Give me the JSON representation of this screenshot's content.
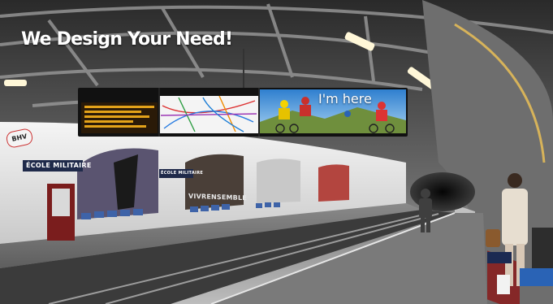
{
  "headline": "We Design Your Need!",
  "screen": {
    "ad_text": "I'm here"
  },
  "signs": {
    "station_left": "ÉCOLE MILITAIRE",
    "station_right": "ÉCOLE MILITAIRE",
    "wall_poster": "VIVRENSEMBLE"
  },
  "logo_text": "BHV",
  "colors": {
    "screen_bezel": "#111111",
    "departure_board": "#e3a21a",
    "ad_sky": "#3b8fd6",
    "bench_blue": "#3e63a8",
    "station_sign_bg": "#1f2a4a"
  }
}
